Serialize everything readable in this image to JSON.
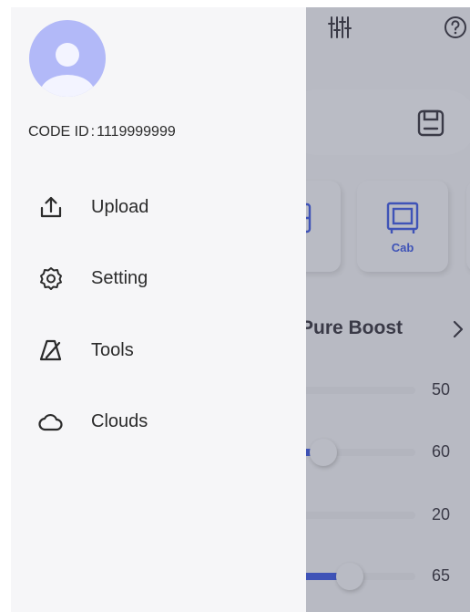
{
  "drawer": {
    "code_id_label": "CODE ID",
    "code_id_separator": ":",
    "code_id_value": "1119999999",
    "menu": [
      {
        "label": "Upload",
        "icon": "upload-icon"
      },
      {
        "label": "Setting",
        "icon": "gear-icon"
      },
      {
        "label": "Tools",
        "icon": "metronome-icon"
      },
      {
        "label": "Clouds",
        "icon": "cloud-icon"
      }
    ]
  },
  "background": {
    "top_icons": [
      "mixer-icon",
      "help-icon"
    ],
    "save_icon": "save-icon",
    "module_label": "Cab",
    "effect_name": "Pure Boost",
    "sliders": [
      {
        "value": "50",
        "fraction": 0.0
      },
      {
        "value": "60",
        "fraction": 0.3
      },
      {
        "value": "20",
        "fraction": 0.0
      },
      {
        "value": "65",
        "fraction": 0.5
      }
    ]
  },
  "colors": {
    "accent": "#3f53b7",
    "avatar": "#b2b9f8",
    "overlay_bg": "#b8bac3",
    "drawer_bg": "#f6f6f8"
  }
}
